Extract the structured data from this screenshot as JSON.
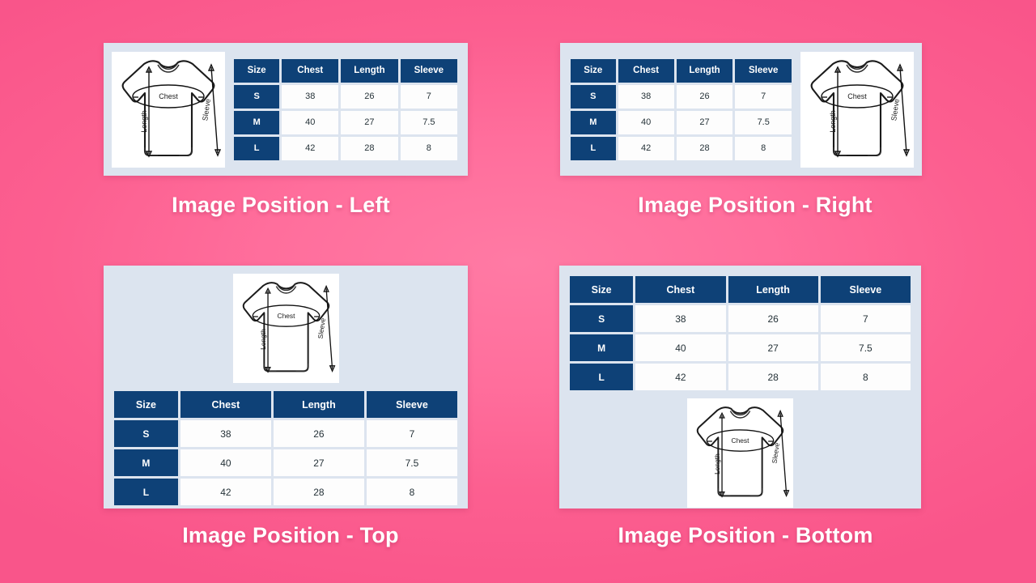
{
  "page": {
    "background_color": "#ff6e9c",
    "accent_color": "#0e4177",
    "panel_color": "#dce4ef"
  },
  "table": {
    "headers": [
      "Size",
      "Chest",
      "Length",
      "Sleeve"
    ],
    "rows": [
      {
        "size": "S",
        "chest": "38",
        "length": "26",
        "sleeve": "7"
      },
      {
        "size": "M",
        "chest": "40",
        "length": "27",
        "sleeve": "7.5"
      },
      {
        "size": "L",
        "chest": "42",
        "length": "28",
        "sleeve": "8"
      }
    ]
  },
  "figure": {
    "label_chest": "Chest",
    "label_length": "Length",
    "label_sleeve": "Sleeve"
  },
  "panels": [
    {
      "id": "left",
      "caption": "Image Position - Left"
    },
    {
      "id": "right",
      "caption": "Image Position - Right"
    },
    {
      "id": "top",
      "caption": "Image Position - Top"
    },
    {
      "id": "bottom",
      "caption": "Image Position - Bottom"
    }
  ]
}
